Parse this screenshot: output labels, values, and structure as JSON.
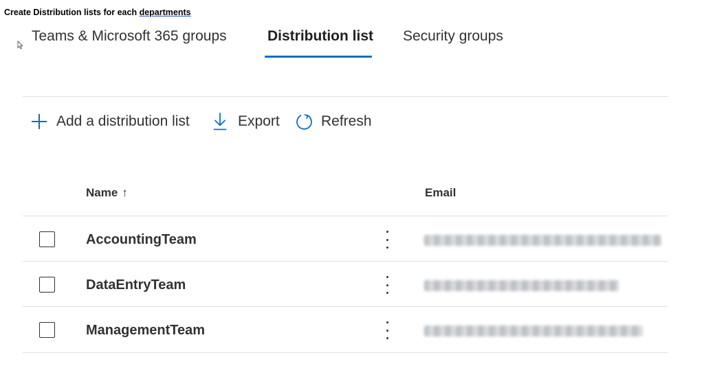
{
  "caption": {
    "text": "Create Distribution lists for each ",
    "link": "departments"
  },
  "tabs": [
    {
      "label": "Teams & Microsoft 365 groups",
      "active": false
    },
    {
      "label": "Distribution list",
      "active": true
    },
    {
      "label": "Security groups",
      "active": false
    }
  ],
  "commands": {
    "add": {
      "label": "Add a distribution list",
      "icon": "plus-icon"
    },
    "export": {
      "label": "Export",
      "icon": "download-icon"
    },
    "refresh": {
      "label": "Refresh",
      "icon": "refresh-icon"
    }
  },
  "table": {
    "columns": {
      "name": "Name",
      "email": "Email"
    },
    "sort_indicator": "↑",
    "rows": [
      {
        "name": "AccountingTeam",
        "email_redacted": true
      },
      {
        "name": "DataEntryTeam",
        "email_redacted": true
      },
      {
        "name": "ManagementTeam",
        "email_redacted": true
      }
    ]
  },
  "colors": {
    "accent": "#0f6cbd",
    "text": "#323130",
    "divider": "#e1dfdd"
  }
}
